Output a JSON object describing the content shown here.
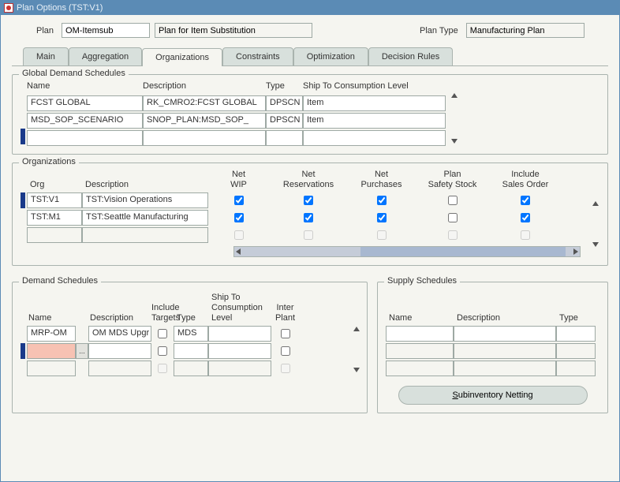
{
  "window": {
    "title": "Plan Options (TST:V1)"
  },
  "header": {
    "plan_label": "Plan",
    "plan_name": "OM-Itemsub",
    "plan_desc": "Plan for Item Substitution",
    "plan_type_label": "Plan Type",
    "plan_type": "Manufacturing Plan"
  },
  "tabs": {
    "main": "Main",
    "aggregation": "Aggregation",
    "organizations": "Organizations",
    "constraints": "Constraints",
    "optimization": "Optimization",
    "decision_rules": "Decision Rules"
  },
  "gds": {
    "title": "Global Demand Schedules",
    "cols": {
      "name": "Name",
      "desc": "Description",
      "type": "Type",
      "ship": "Ship To Consumption Level"
    },
    "rows": [
      {
        "name": "FCST GLOBAL",
        "desc": "RK_CMRO2:FCST GLOBAL",
        "type": "DPSCN",
        "ship": "Item"
      },
      {
        "name": "MSD_SOP_SCENARIO",
        "desc": "SNOP_PLAN:MSD_SOP_",
        "type": "DPSCN",
        "ship": "Item"
      },
      {
        "name": "",
        "desc": "",
        "type": "",
        "ship": ""
      }
    ]
  },
  "orgs": {
    "title": "Organizations",
    "cols": {
      "org": "Org",
      "desc": "Description",
      "netwip": "Net\nWIP",
      "netres": "Net\nReservations",
      "netpurch": "Net\nPurchases",
      "safety": "Plan\nSafety Stock",
      "incso": "Include\nSales Order"
    },
    "rows": [
      {
        "org": "TST:V1",
        "desc": "TST:Vision Operations",
        "netwip": true,
        "netres": true,
        "netpurch": true,
        "safety": false,
        "incso": true
      },
      {
        "org": "TST:M1",
        "desc": "TST:Seattle Manufacturing",
        "netwip": true,
        "netres": true,
        "netpurch": true,
        "safety": false,
        "incso": true
      },
      {
        "org": "",
        "desc": "",
        "netwip": false,
        "netres": false,
        "netpurch": false,
        "safety": false,
        "incso": false
      }
    ]
  },
  "demand": {
    "title": "Demand Schedules",
    "cols": {
      "name": "Name",
      "desc": "Description",
      "inc_targets": "Include\nTargets",
      "type": "Type",
      "ship": "Ship To\nConsumption\nLevel",
      "inter": "Inter\nPlant"
    },
    "rows": [
      {
        "name": "MRP-OM",
        "desc": "OM MDS Upgr",
        "inc": false,
        "type": "MDS",
        "ship": "",
        "inter": false
      },
      {
        "name": "",
        "desc": "",
        "inc": false,
        "type": "",
        "ship": "",
        "inter": false,
        "selected": true
      },
      {
        "name": "",
        "desc": "",
        "inc": false,
        "type": "",
        "ship": "",
        "inter": false
      }
    ],
    "lov": "..."
  },
  "supply": {
    "title": "Supply Schedules",
    "cols": {
      "name": "Name",
      "desc": "Description",
      "type": "Type"
    },
    "rows": [
      {
        "name": "",
        "desc": "",
        "type": ""
      },
      {
        "name": "",
        "desc": "",
        "type": ""
      },
      {
        "name": "",
        "desc": "",
        "type": ""
      }
    ],
    "button": "Subinventory Netting"
  }
}
